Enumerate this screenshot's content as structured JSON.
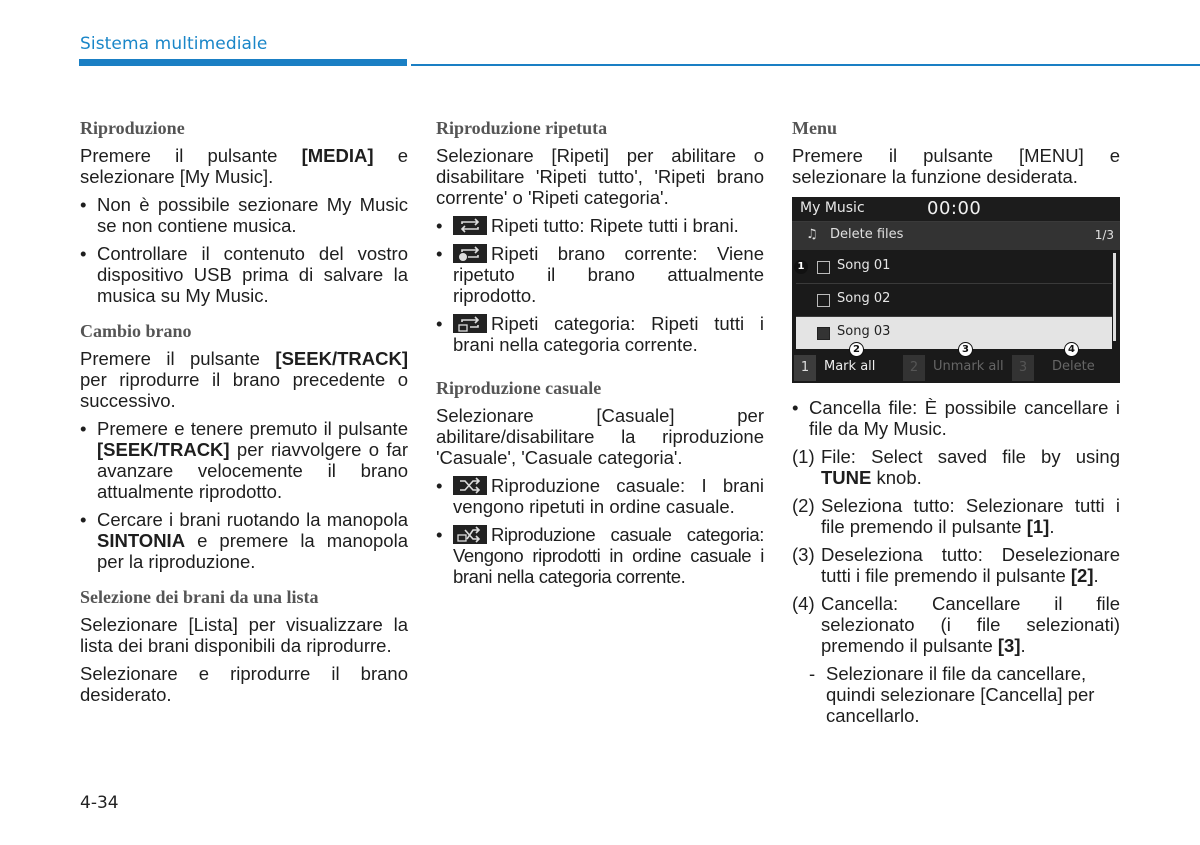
{
  "header": {
    "title": "Sistema multimediale",
    "accent_color": "#1a7fc4"
  },
  "page_number": "4-34",
  "col1": {
    "s1": {
      "heading": "Riproduzione",
      "p_pre": "Premere il pulsante ",
      "p_bold": "[MEDIA]",
      "p_post": " e selezionare [My Music].",
      "bullets": [
        "Non è possibile sezionare My Music se non contiene musica.",
        "Controllare il contenuto del vostro dispositivo USB prima di salvare la musica su My Music."
      ]
    },
    "s2": {
      "heading": "Cambio brano",
      "p_pre": "Premere il pulsante ",
      "p_bold": "[SEEK/TRACK]",
      "p_post": " per riprodurre il brano precedente o successivo.",
      "b1_pre": "Premere e tenere premuto il pulsante ",
      "b1_bold": "[SEEK/TRACK]",
      "b1_post": " per riavvolgere o far avanzare velocemente il brano attualmente riprodotto.",
      "b2_pre": "Cercare i brani ruotando la manopola ",
      "b2_bold": "SINTONIA",
      "b2_post": " e premere la manopola per la riproduzione."
    },
    "s3": {
      "heading": "Selezione dei brani da una lista",
      "p1": "Selezionare [Lista] per visualizzare la lista dei brani disponibili da riprodurre.",
      "p2": "Selezionare e riprodurre il brano desiderato."
    }
  },
  "col2": {
    "s1": {
      "heading": "Riproduzione ripetuta",
      "p": "Selezionare [Ripeti] per abilitare o disabilitare 'Ripeti tutto', 'Ripeti brano corrente' o 'Ripeti categoria'.",
      "bullets": [
        {
          "icon": "repeat-all-icon",
          "text": "Ripeti tutto: Ripete tutti i brani."
        },
        {
          "icon": "repeat-one-icon",
          "text": "Ripeti brano corrente: Viene ripetuto il brano attualmente riprodotto."
        },
        {
          "icon": "repeat-category-icon",
          "text": "Ripeti categoria: Ripeti tutti i brani nella categoria corrente."
        }
      ]
    },
    "s2": {
      "heading": "Riproduzione casuale",
      "p": "Selezionare [Casuale] per abilitare/disabilitare la riproduzione 'Casuale', 'Casuale categoria'.",
      "bullets": [
        {
          "icon": "shuffle-icon",
          "text": "Riproduzione casuale: I brani vengono ripetuti in ordine casuale."
        },
        {
          "icon": "shuffle-category-icon",
          "text": "Riproduzione casuale categoria: Vengono riprodotti in ordine casuale i brani nella categoria corrente."
        }
      ]
    }
  },
  "col3": {
    "heading": "Menu",
    "p": "Premere il pulsante [MENU] e selezionare la funzione desiderata.",
    "screen": {
      "title": "My Music",
      "time": "00:00",
      "sub_icon": "music-note-icon",
      "sub_label": "Delete files",
      "page": "1/3",
      "songs": [
        {
          "label": "Song 01",
          "checked": false,
          "selected": false
        },
        {
          "label": "Song 02",
          "checked": false,
          "selected": false
        },
        {
          "label": "Song 03",
          "checked": true,
          "selected": true
        }
      ],
      "buttons": [
        {
          "key": "1",
          "label": "Mark all",
          "enabled": true
        },
        {
          "key": "2",
          "label": "Unmark all",
          "enabled": false
        },
        {
          "key": "3",
          "label": "Delete",
          "enabled": false
        }
      ],
      "markers": [
        "1",
        "2",
        "3",
        "4"
      ]
    },
    "bullet": "Cancella file: È possibile cancellare i file da My Music.",
    "items": [
      {
        "num": "(1)",
        "pre": "File: Select saved file by using ",
        "bold": "TUNE",
        "post": " knob."
      },
      {
        "num": "(2)",
        "pre": "Seleziona tutto: Selezionare tutti i file premendo il pulsante ",
        "bold": "[1]",
        "post": "."
      },
      {
        "num": "(3)",
        "pre": "Deseleziona tutto: Deselezionare tutti i file premendo il pulsante ",
        "bold": "[2]",
        "post": "."
      },
      {
        "num": "(4)",
        "pre": "Cancella: Cancellare il file selezionato (i file selezionati) premendo il pulsante ",
        "bold": "[3]",
        "post": "."
      }
    ],
    "dash": "Selezionare il file da cancellare, quindi selezionare [Cancella] per cancellarlo."
  }
}
